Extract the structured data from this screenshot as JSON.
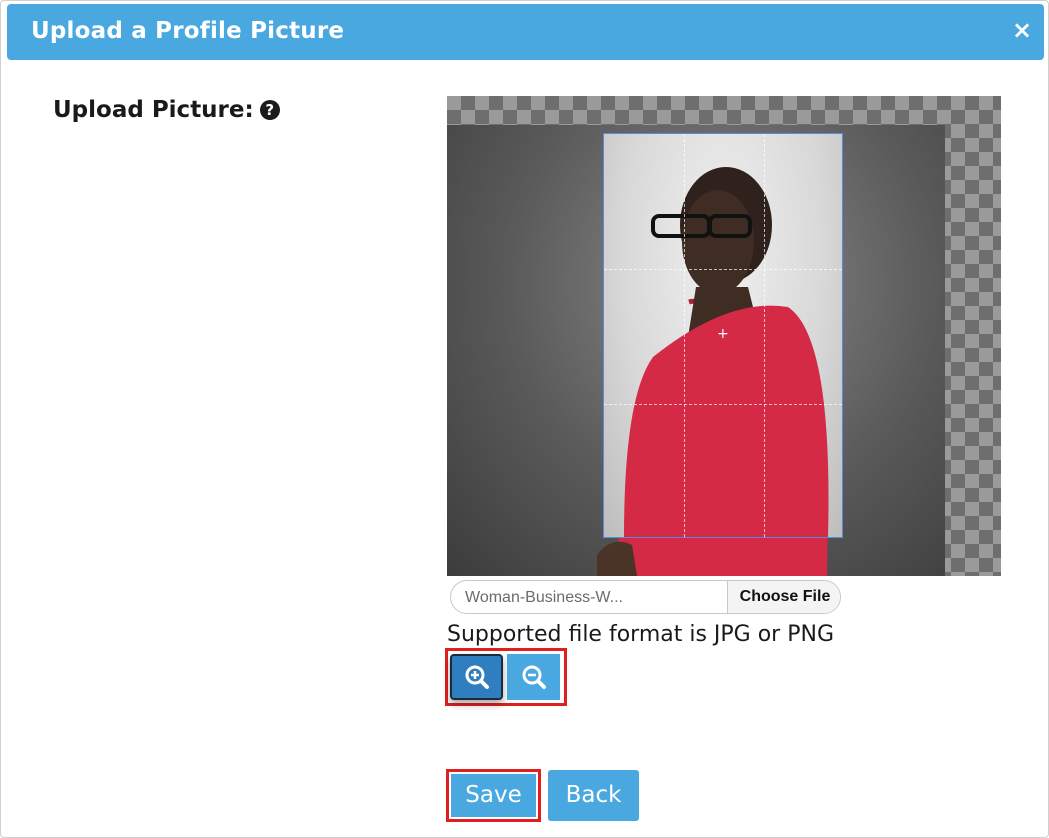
{
  "modal": {
    "title": "Upload a Profile Picture",
    "close_icon": "×"
  },
  "form": {
    "label": "Upload Picture:",
    "help_icon": "question-circle"
  },
  "file_input": {
    "file_name": "Woman-Business-W...",
    "choose_label": "Choose File"
  },
  "support_text": "Supported file format is JPG or PNG",
  "zoom": {
    "in_icon": "zoom-in-icon",
    "out_icon": "zoom-out-icon"
  },
  "actions": {
    "save_label": "Save",
    "back_label": "Back"
  },
  "colors": {
    "primary": "#4aa8e0",
    "highlight": "#e02020"
  }
}
